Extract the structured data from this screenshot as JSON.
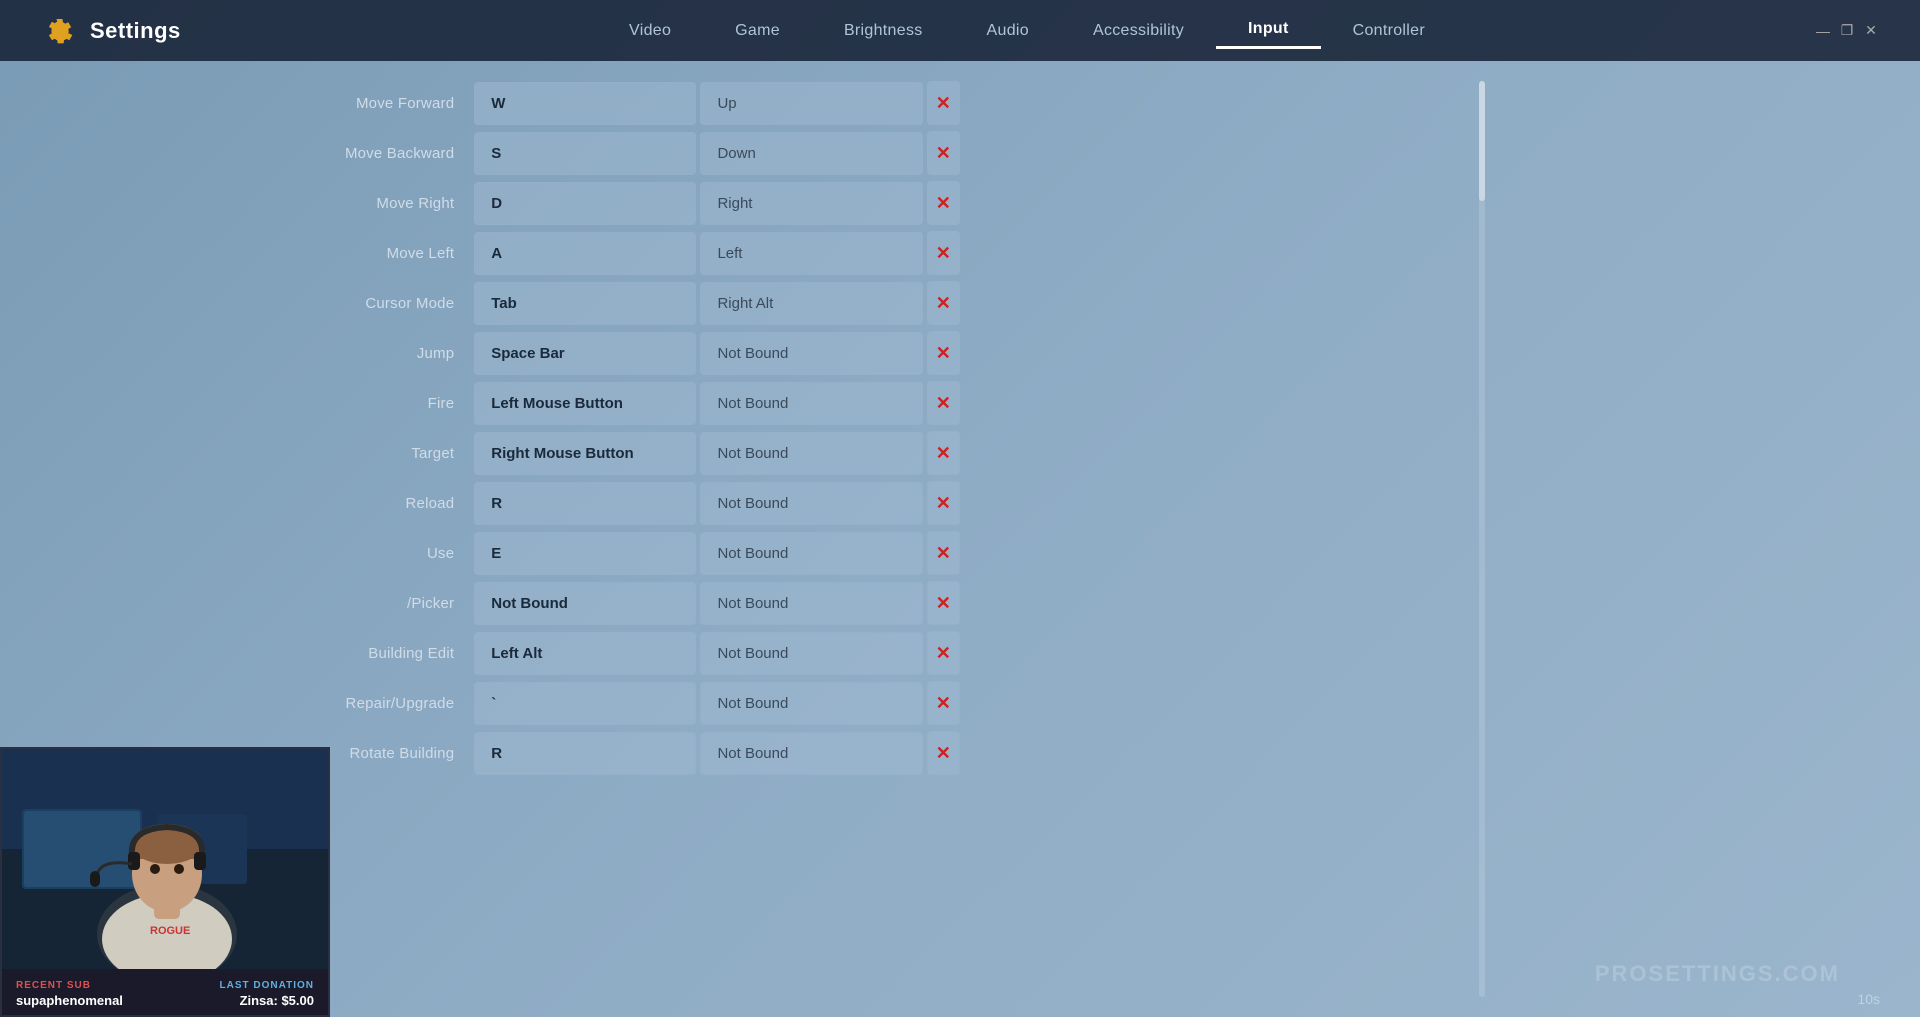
{
  "window": {
    "title": "Settings",
    "controls": {
      "minimize": "—",
      "maximize": "❐",
      "close": "✕"
    }
  },
  "header": {
    "logo_alt": "Settings Gear",
    "title": "Settings",
    "tabs": [
      {
        "label": "Video",
        "active": false
      },
      {
        "label": "Game",
        "active": false
      },
      {
        "label": "Brightness",
        "active": false
      },
      {
        "label": "Audio",
        "active": false
      },
      {
        "label": "Accessibility",
        "active": false
      },
      {
        "label": "Input",
        "active": true
      },
      {
        "label": "Controller",
        "active": false
      }
    ]
  },
  "bindings": [
    {
      "action": "Move Forward",
      "primary": "W",
      "alt": "Up",
      "has_primary": true,
      "has_alt": true
    },
    {
      "action": "Move Backward",
      "primary": "S",
      "alt": "Down",
      "has_primary": true,
      "has_alt": true
    },
    {
      "action": "Move Right",
      "primary": "D",
      "alt": "Right",
      "has_primary": true,
      "has_alt": true
    },
    {
      "action": "Move Left",
      "primary": "A",
      "alt": "Left",
      "has_primary": true,
      "has_alt": true
    },
    {
      "action": "Cursor Mode",
      "primary": "Tab",
      "alt": "Right Alt",
      "has_primary": true,
      "has_alt": true
    },
    {
      "action": "Jump",
      "primary": "Space Bar",
      "alt": "Not Bound",
      "has_primary": true,
      "has_alt": false
    },
    {
      "action": "Fire",
      "primary": "Left Mouse Button",
      "alt": "Not Bound",
      "has_primary": true,
      "has_alt": false
    },
    {
      "action": "Target",
      "primary": "Right Mouse Button",
      "alt": "Not Bound",
      "has_primary": true,
      "has_alt": false
    },
    {
      "action": "Reload",
      "primary": "R",
      "alt": "Not Bound",
      "has_primary": true,
      "has_alt": false
    },
    {
      "action": "Use",
      "primary": "E",
      "alt": "Not Bound",
      "has_primary": true,
      "has_alt": false
    },
    {
      "action": "/Picker",
      "primary": "Not Bound",
      "alt": "Not Bound",
      "has_primary": false,
      "has_alt": false
    },
    {
      "action": "Building Edit",
      "primary": "Left Alt",
      "alt": "Not Bound",
      "has_primary": true,
      "has_alt": false
    },
    {
      "action": "Repair/Upgrade",
      "primary": "`",
      "alt": "Not Bound",
      "has_primary": true,
      "has_alt": false
    },
    {
      "action": "Rotate Building",
      "primary": "R",
      "alt": "Not Bound",
      "has_primary": true,
      "has_alt": false
    }
  ],
  "webcam": {
    "recent_sub_label": "RECENT SUB",
    "recent_sub_name": "supaphenomenal",
    "last_donation_label": "LAST DONATION",
    "last_donation_value": "Zinsa: $5.00"
  },
  "watermark": {
    "text": "PROSETTINGS.COM",
    "timer": "10s"
  },
  "colors": {
    "accent": "#cc2222",
    "active_tab_border": "#ffffff",
    "bg_primary": "#8fa8c8",
    "header_bg": "rgba(20,30,50,0.85)"
  }
}
